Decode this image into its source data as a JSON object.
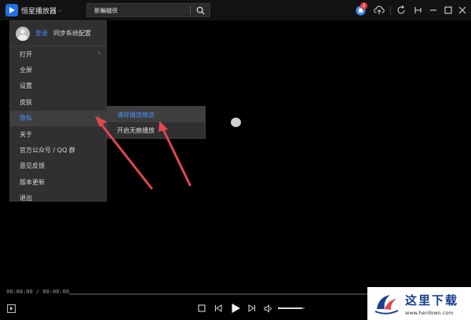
{
  "titlebar": {
    "app_name": "恒星播放器",
    "search_value": "新蝙蝠侠",
    "notification_count": "2"
  },
  "menu": {
    "login_label": "登录",
    "sync_label": "同步系统配置",
    "items": [
      {
        "label": "打开",
        "has_submenu": true
      },
      {
        "label": "全屏",
        "has_submenu": false
      },
      {
        "label": "设置",
        "has_submenu": false
      },
      {
        "label": "皮肤",
        "has_submenu": false
      },
      {
        "label": "隐私",
        "has_submenu": true,
        "active": true
      },
      {
        "label": "关于",
        "has_submenu": false
      },
      {
        "label": "官方公众号 / QQ 群",
        "has_submenu": false
      },
      {
        "label": "意见反馈",
        "has_submenu": false
      },
      {
        "label": "版本更新",
        "has_submenu": false
      },
      {
        "label": "退出",
        "has_submenu": false
      }
    ],
    "submenu_arrow": "›"
  },
  "submenu": {
    "items": [
      {
        "label": "清除播放痕迹",
        "active": true
      },
      {
        "label": "开启无痕播放",
        "active": false
      }
    ]
  },
  "player": {
    "time": "00:00:00 / 00:00:00",
    "volume_level": 0.9
  },
  "watermark": {
    "cn_text": "这里下载",
    "url": "www.herdown.com"
  },
  "icons": {
    "logo": "play-logo-icon",
    "search": "search-icon",
    "notification": "notification-icon",
    "cloud": "cloud-upload-icon",
    "refresh": "refresh-icon",
    "pin": "pin-icon",
    "minimize": "minimize-icon",
    "maximize": "maximize-icon",
    "close": "close-icon"
  },
  "colors": {
    "accent": "#4a90f5",
    "brand": "#1f6fe6",
    "badge": "#e63939",
    "annotation_arrow": "#e2474f"
  }
}
